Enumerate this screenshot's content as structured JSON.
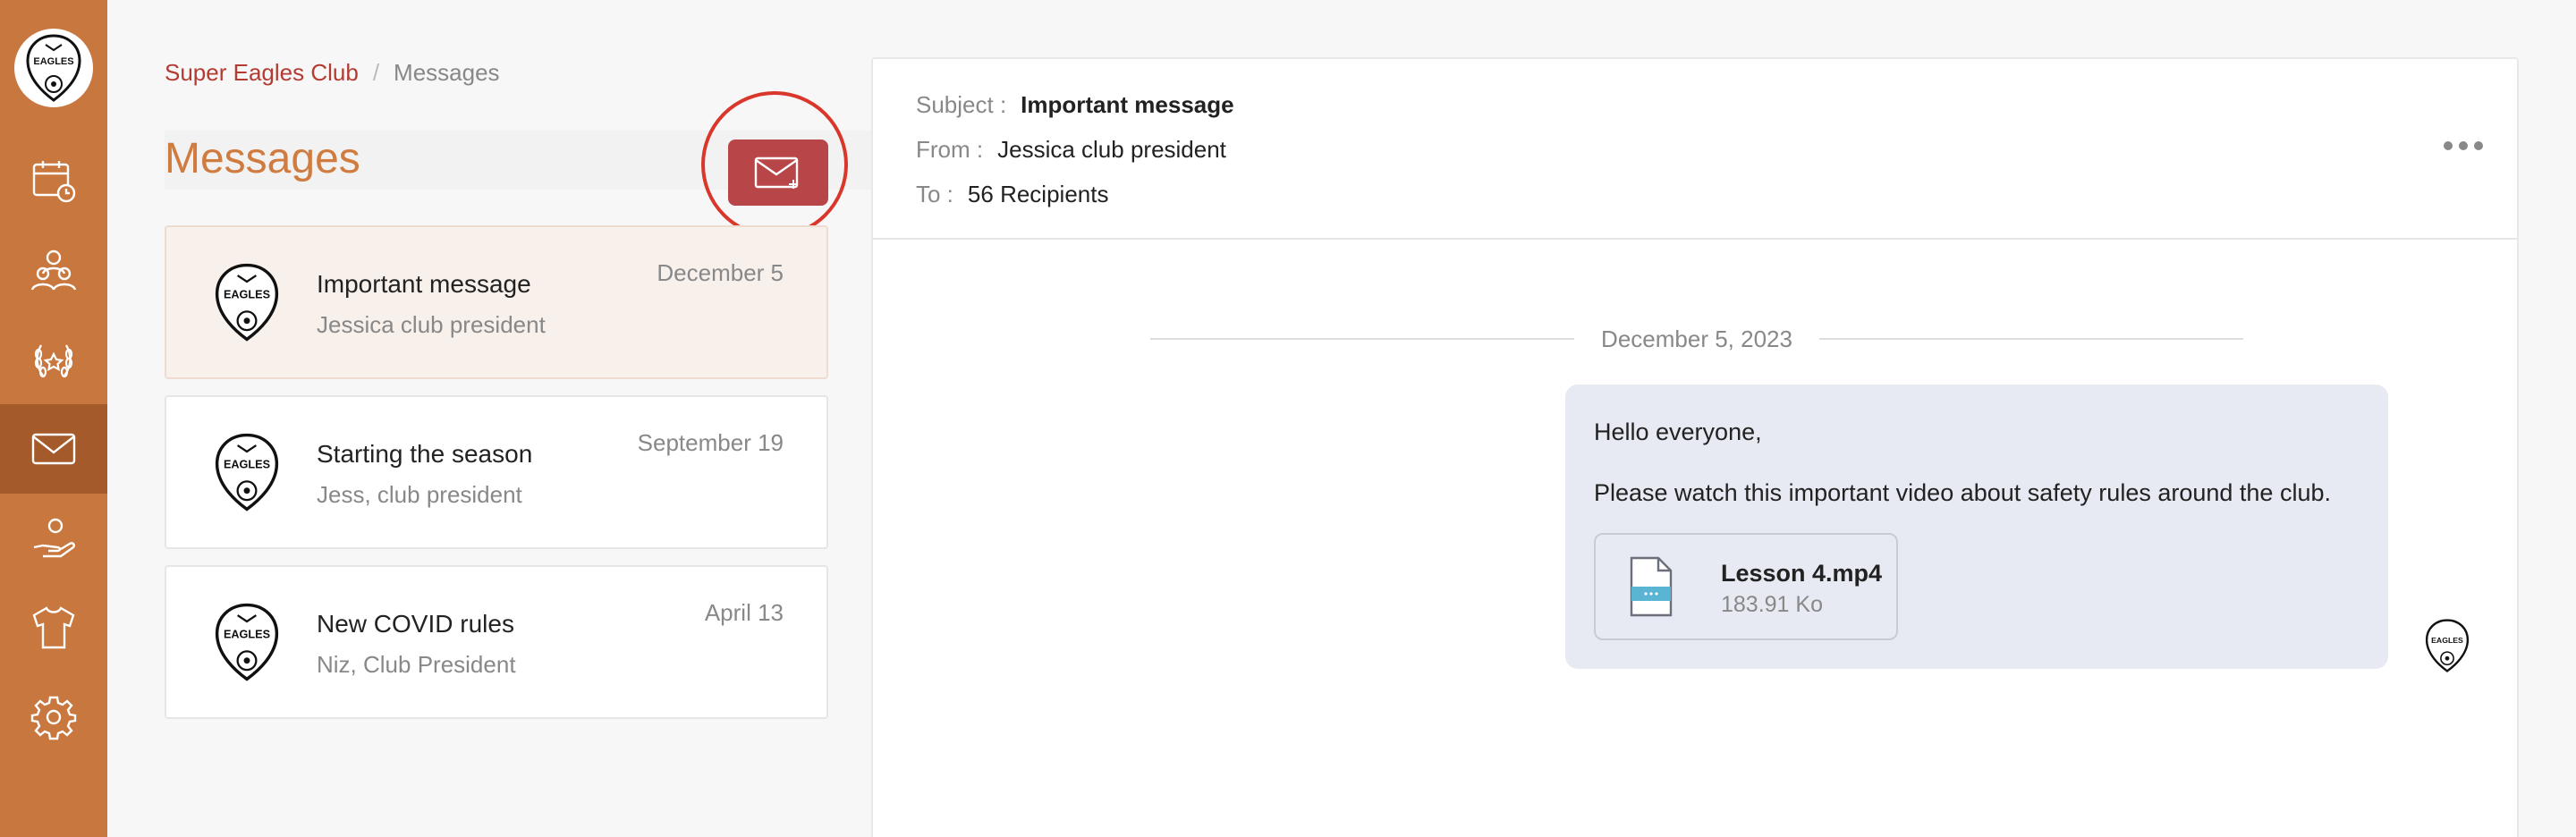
{
  "sidebar": {
    "logo_icon": "eagles-crest-logo",
    "items": [
      {
        "icon": "calendar-icon",
        "active": false
      },
      {
        "icon": "members-icon",
        "active": false
      },
      {
        "icon": "laurel-icon",
        "active": false
      },
      {
        "icon": "mail-icon",
        "active": true
      },
      {
        "icon": "hand-heart-icon",
        "active": false
      },
      {
        "icon": "shirt-icon",
        "active": false
      },
      {
        "icon": "gear-icon",
        "active": false
      }
    ],
    "color": "#c8773e",
    "active_color": "#a45a2b"
  },
  "breadcrumb": {
    "club": "Super Eagles Club",
    "separator": "/",
    "current": "Messages"
  },
  "page_title": "Messages",
  "compose_button": {
    "icon": "new-mail-icon",
    "color": "#b84548"
  },
  "messages": [
    {
      "subject": "Important message",
      "from": "Jessica club president",
      "date": "December 5",
      "selected": true
    },
    {
      "subject": "Starting the season",
      "from": "Jess, club president",
      "date": "September 19",
      "selected": false
    },
    {
      "subject": "New COVID rules",
      "from": "Niz, Club President",
      "date": "April 13",
      "selected": false
    }
  ],
  "detail": {
    "subject_label": "Subject :",
    "subject": "Important message",
    "from_label": "From :",
    "from": "Jessica club president",
    "to_label": "To :",
    "to": "56 Recipients",
    "date_separator": "December 5, 2023",
    "body_greeting": "Hello everyone,",
    "body_text": "Please watch this important video about safety rules around the club.",
    "attachment": {
      "name": "Lesson 4.mp4",
      "size": "183.91 Ko",
      "icon": "video-file-icon"
    }
  },
  "colors": {
    "accent": "#d07b40",
    "brand_red": "#b43b32",
    "highlight_ring": "#d9372b"
  }
}
